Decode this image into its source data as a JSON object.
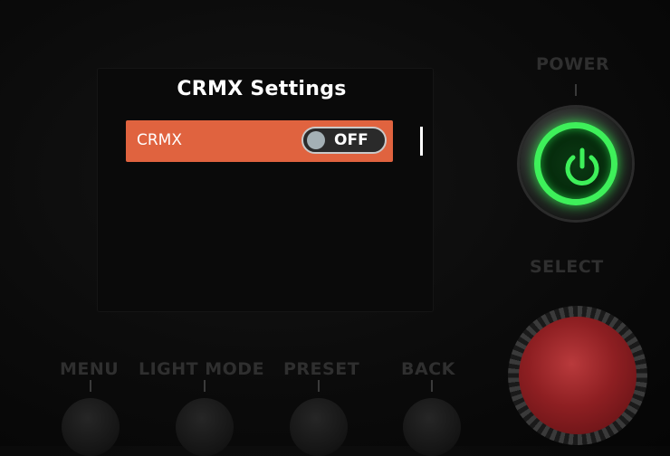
{
  "screen": {
    "title": "CRMX Settings",
    "items": [
      {
        "label": "CRMX",
        "toggle_state": "OFF"
      }
    ]
  },
  "hardware": {
    "power_label": "POWER",
    "select_label": "SELECT",
    "buttons": [
      "MENU",
      "LIGHT MODE",
      "PRESET",
      "BACK"
    ],
    "power_led_color": "#3ef05a",
    "highlight_color": "#e0633f"
  }
}
